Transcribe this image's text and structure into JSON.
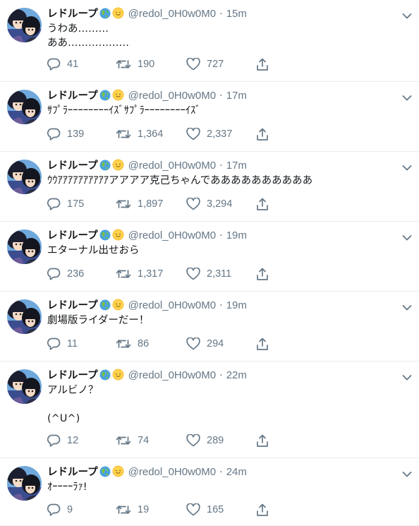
{
  "user": {
    "display_name": "レドループ",
    "handle": "@redol_0H0w0M0",
    "badges": [
      "globe-emoji",
      "sun-emoji"
    ]
  },
  "colors": {
    "text": "#14171a",
    "meta": "#657786",
    "divider": "#e6ecf0"
  },
  "tweets": [
    {
      "time": "15m",
      "text": "うわあ………\nああ………………",
      "replies": "41",
      "retweets": "190",
      "likes": "727"
    },
    {
      "time": "17m",
      "text": "ｻﾌﾟﾗｰｰｰｰｰｰｰｰｲｽﾞｻﾌﾟﾗｰｰｰｰｰｰｰｰｲｽﾞ",
      "replies": "139",
      "retweets": "1,364",
      "likes": "2,337"
    },
    {
      "time": "17m",
      "text": "ｳｳｱｱｱｱｱｱｱｱｱｱアアアア克己ちゃんでああああああああああ",
      "replies": "175",
      "retweets": "1,897",
      "likes": "3,294"
    },
    {
      "time": "19m",
      "text": "エターナル出せおら",
      "replies": "236",
      "retweets": "1,317",
      "likes": "2,311"
    },
    {
      "time": "19m",
      "text": "劇場版ライダーだー！",
      "replies": "11",
      "retweets": "86",
      "likes": "294"
    },
    {
      "time": "22m",
      "text": "アルビノ？\n\n(^U^)",
      "replies": "12",
      "retweets": "74",
      "likes": "289"
    },
    {
      "time": "24m",
      "text": "ｵｰｰｰｰﾗｧ!",
      "replies": "9",
      "retweets": "19",
      "likes": "165"
    }
  ]
}
